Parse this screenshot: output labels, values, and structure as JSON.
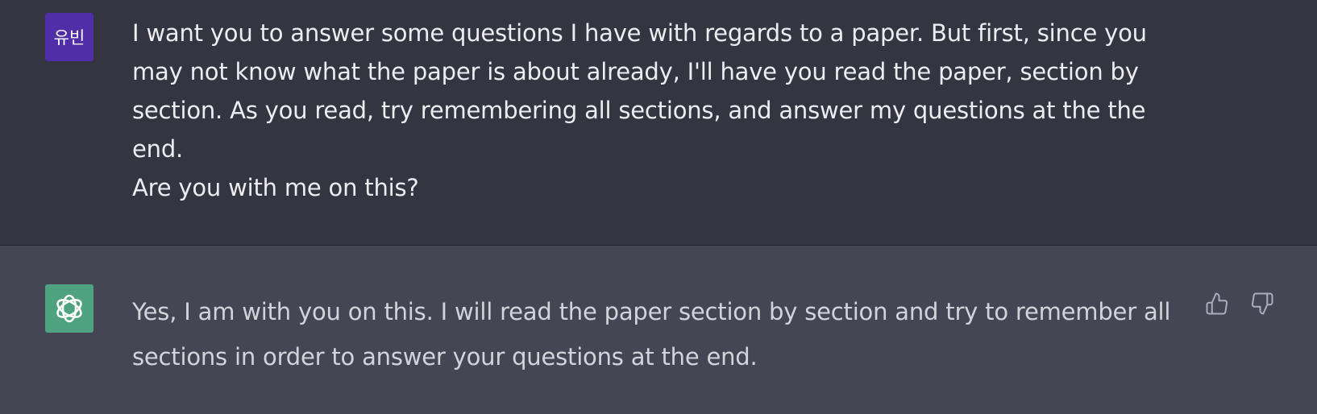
{
  "messages": {
    "user": {
      "avatar_text": "유빈",
      "line1": "I want you to answer some questions I have with regards to a paper.  But first, since you may not know what the paper is about already, I'll have you read the paper, section by section. As you read, try remembering all sections, and answer my questions at the the end.",
      "line2": "Are you with me on this?"
    },
    "assistant": {
      "avatar_icon": "openai-logo-icon",
      "text": "Yes, I am with you on this. I will read the paper section by section and try to remember all sections in order to answer your questions at the end."
    }
  },
  "colors": {
    "user_bg": "#343541",
    "assistant_bg": "#444654",
    "user_avatar": "#4f2ea7",
    "assistant_avatar": "#4fa27f"
  },
  "feedback": {
    "thumbs_up_icon": "thumbs-up-icon",
    "thumbs_down_icon": "thumbs-down-icon"
  }
}
